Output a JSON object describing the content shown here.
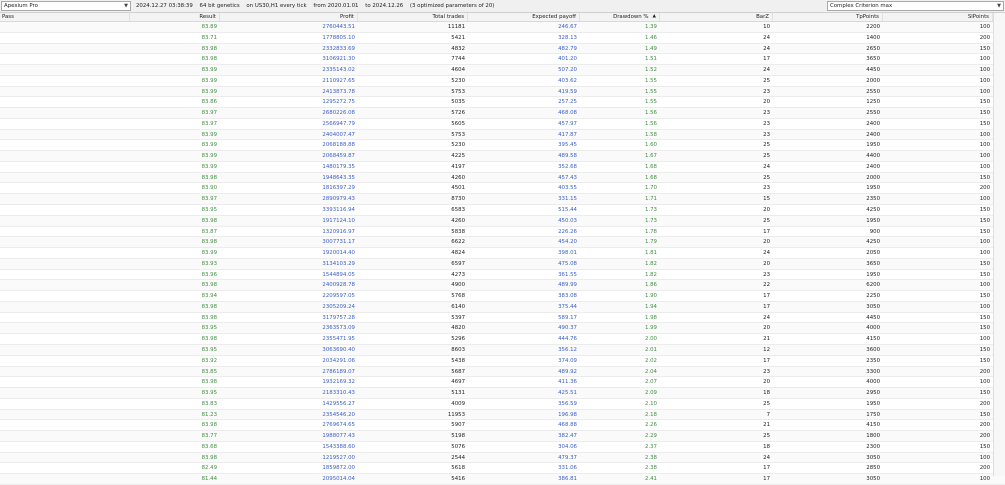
{
  "toolbar": {
    "expert": "Apexium Pro",
    "info": [
      "2024.12.27 03:38:39",
      "64 bit genetics",
      "on US30,H1 every tick",
      "from 2020.01.01",
      "to 2024.12.26",
      "(3 optimized parameters of 20)"
    ],
    "criterion": "Complex Criterion max"
  },
  "columns": [
    "Pass",
    "Result",
    "Profit",
    "Total trades",
    "Expected payoff",
    "Drawdown %",
    "BarZ",
    "TpPoints",
    "SlPoints"
  ],
  "sort_column": "Drawdown %",
  "colors": {
    "result": "#3f8f3f",
    "profit": "#3a5fc7",
    "text": "#222222"
  },
  "rows": [
    [
      "",
      "83.89",
      "2760443.51",
      "11181",
      "246.67",
      "1.39",
      "10",
      "2200",
      "100"
    ],
    [
      "",
      "83.71",
      "1778805.10",
      "5421",
      "328.13",
      "1.46",
      "24",
      "1400",
      "200"
    ],
    [
      "",
      "83.98",
      "2332833.69",
      "4832",
      "482.79",
      "1.49",
      "24",
      "2650",
      "150"
    ],
    [
      "",
      "83.98",
      "3106921.30",
      "7744",
      "401.20",
      "1.51",
      "17",
      "3650",
      "100"
    ],
    [
      "",
      "83.99",
      "2335143.02",
      "4604",
      "507.20",
      "1.52",
      "24",
      "4450",
      "100"
    ],
    [
      "",
      "83.99",
      "2110927.65",
      "5230",
      "403.62",
      "1.55",
      "25",
      "2000",
      "100"
    ],
    [
      "",
      "83.99",
      "2413873.78",
      "5753",
      "419.59",
      "1.55",
      "23",
      "2550",
      "100"
    ],
    [
      "",
      "83.86",
      "1295272.75",
      "5035",
      "257.25",
      "1.55",
      "20",
      "1250",
      "150"
    ],
    [
      "",
      "83.97",
      "2680226.08",
      "5726",
      "468.08",
      "1.56",
      "23",
      "2550",
      "150"
    ],
    [
      "",
      "83.97",
      "2566947.79",
      "5605",
      "457.97",
      "1.56",
      "23",
      "2400",
      "150"
    ],
    [
      "",
      "83.99",
      "2404007.47",
      "5753",
      "417.87",
      "1.58",
      "23",
      "2400",
      "100"
    ],
    [
      "",
      "83.99",
      "2068188.88",
      "5230",
      "395.45",
      "1.60",
      "25",
      "1950",
      "100"
    ],
    [
      "",
      "83.99",
      "2068459.87",
      "4225",
      "489.58",
      "1.67",
      "25",
      "4400",
      "100"
    ],
    [
      "",
      "83.99",
      "1480179.35",
      "4197",
      "352.68",
      "1.68",
      "24",
      "2400",
      "100"
    ],
    [
      "",
      "83.98",
      "1948643.35",
      "4260",
      "457.43",
      "1.68",
      "25",
      "2000",
      "150"
    ],
    [
      "",
      "83.90",
      "1816397.29",
      "4501",
      "403.55",
      "1.70",
      "23",
      "1950",
      "200"
    ],
    [
      "",
      "83.97",
      "2890979.43",
      "8730",
      "331.15",
      "1.71",
      "15",
      "2350",
      "100"
    ],
    [
      "",
      "83.95",
      "3393116.94",
      "6583",
      "515.44",
      "1.73",
      "20",
      "4250",
      "150"
    ],
    [
      "",
      "83.98",
      "1917124.10",
      "4260",
      "450.03",
      "1.73",
      "25",
      "1950",
      "150"
    ],
    [
      "",
      "83.87",
      "1320916.97",
      "5838",
      "226.26",
      "1.78",
      "17",
      "900",
      "150"
    ],
    [
      "",
      "83.98",
      "3007731.17",
      "6622",
      "454.20",
      "1.79",
      "20",
      "4250",
      "100"
    ],
    [
      "",
      "83.99",
      "1920014.40",
      "4824",
      "398.01",
      "1.81",
      "24",
      "2050",
      "100"
    ],
    [
      "",
      "83.93",
      "3134103.29",
      "6597",
      "475.08",
      "1.82",
      "20",
      "3650",
      "150"
    ],
    [
      "",
      "83.96",
      "1544894.05",
      "4273",
      "361.55",
      "1.82",
      "23",
      "1950",
      "150"
    ],
    [
      "",
      "83.98",
      "2400928.78",
      "4900",
      "489.99",
      "1.86",
      "22",
      "6200",
      "100"
    ],
    [
      "",
      "83.94",
      "2209597.05",
      "5768",
      "383.08",
      "1.90",
      "17",
      "2250",
      "150"
    ],
    [
      "",
      "83.98",
      "2305209.24",
      "6140",
      "375.44",
      "1.94",
      "17",
      "3050",
      "100"
    ],
    [
      "",
      "83.98",
      "3179757.28",
      "5397",
      "589.17",
      "1.98",
      "24",
      "4450",
      "150"
    ],
    [
      "",
      "83.95",
      "2363573.09",
      "4820",
      "490.37",
      "1.99",
      "20",
      "4000",
      "150"
    ],
    [
      "",
      "83.98",
      "2355471.95",
      "5296",
      "444.76",
      "2.00",
      "21",
      "4150",
      "100"
    ],
    [
      "",
      "83.95",
      "3063690.40",
      "8603",
      "356.12",
      "2.01",
      "12",
      "3600",
      "150"
    ],
    [
      "",
      "83.92",
      "2034291.06",
      "5438",
      "374.09",
      "2.02",
      "17",
      "2350",
      "150"
    ],
    [
      "",
      "83.85",
      "2786189.07",
      "5687",
      "489.92",
      "2.04",
      "23",
      "3300",
      "200"
    ],
    [
      "",
      "83.98",
      "1932169.32",
      "4697",
      "411.36",
      "2.07",
      "20",
      "4000",
      "100"
    ],
    [
      "",
      "83.95",
      "2183310.43",
      "5131",
      "425.51",
      "2.09",
      "18",
      "2950",
      "150"
    ],
    [
      "",
      "83.83",
      "1429556.27",
      "4009",
      "356.59",
      "2.10",
      "25",
      "1950",
      "200"
    ],
    [
      "",
      "81.23",
      "2354546.20",
      "11953",
      "196.98",
      "2.18",
      "7",
      "1750",
      "150"
    ],
    [
      "",
      "83.98",
      "2769674.65",
      "5907",
      "468.88",
      "2.26",
      "21",
      "4150",
      "200"
    ],
    [
      "",
      "83.77",
      "1988077.43",
      "5198",
      "382.47",
      "2.29",
      "25",
      "1800",
      "200"
    ],
    [
      "",
      "83.68",
      "1543388.60",
      "5076",
      "304.06",
      "2.37",
      "18",
      "2300",
      "150"
    ],
    [
      "",
      "83.98",
      "1219527.00",
      "2544",
      "479.37",
      "2.38",
      "24",
      "3050",
      "100"
    ],
    [
      "",
      "82.49",
      "1859872.00",
      "5618",
      "331.06",
      "2.38",
      "17",
      "2850",
      "200"
    ],
    [
      "",
      "81.44",
      "2095014.04",
      "5416",
      "386.81",
      "2.41",
      "17",
      "3050",
      "100"
    ]
  ]
}
